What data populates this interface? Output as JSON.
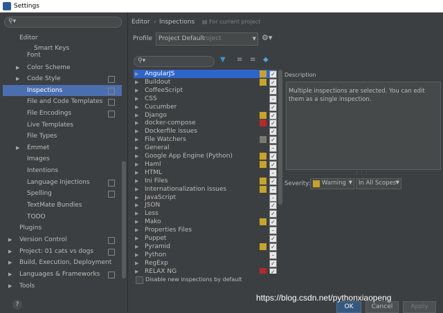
{
  "window": {
    "title": "Settings"
  },
  "sidebar": {
    "search_placeholder": "",
    "items": [
      {
        "label": "Editor",
        "indent": 0,
        "expandable": false
      },
      {
        "label": "Smart Keys",
        "indent": 2,
        "expandable": false
      },
      {
        "label": "Font",
        "indent": 1,
        "expandable": false
      },
      {
        "label": "Color Scheme",
        "indent": 1,
        "expandable": true
      },
      {
        "label": "Code Style",
        "indent": 1,
        "expandable": true,
        "project": true
      },
      {
        "label": "Inspections",
        "indent": 1,
        "expandable": false,
        "project": true,
        "selected": true
      },
      {
        "label": "File and Code Templates",
        "indent": 1,
        "expandable": false,
        "project": true
      },
      {
        "label": "File Encodings",
        "indent": 1,
        "expandable": false,
        "project": true
      },
      {
        "label": "Live Templates",
        "indent": 1,
        "expandable": false
      },
      {
        "label": "File Types",
        "indent": 1,
        "expandable": false
      },
      {
        "label": "Emmet",
        "indent": 1,
        "expandable": true
      },
      {
        "label": "Images",
        "indent": 1,
        "expandable": false
      },
      {
        "label": "Intentions",
        "indent": 1,
        "expandable": false
      },
      {
        "label": "Language Injections",
        "indent": 1,
        "expandable": false,
        "project": true
      },
      {
        "label": "Spelling",
        "indent": 1,
        "expandable": false,
        "project": true
      },
      {
        "label": "TextMate Bundles",
        "indent": 1,
        "expandable": false
      },
      {
        "label": "TODO",
        "indent": 1,
        "expandable": false
      },
      {
        "label": "Plugins",
        "indent": 0,
        "expandable": false
      },
      {
        "label": "Version Control",
        "indent": 0,
        "expandable": true,
        "project": true
      },
      {
        "label": "Project: 01 cats vs dogs",
        "indent": 0,
        "expandable": true,
        "project": true
      },
      {
        "label": "Build, Execution, Deployment",
        "indent": 0,
        "expandable": true
      },
      {
        "label": "Languages & Frameworks",
        "indent": 0,
        "expandable": true,
        "project": true
      },
      {
        "label": "Tools",
        "indent": 0,
        "expandable": true
      }
    ]
  },
  "breadcrumb": {
    "editor": "Editor",
    "inspections": "Inspections",
    "for_project": "For current project"
  },
  "profile": {
    "label": "Profile",
    "value": "Project Default",
    "suffix": "Project"
  },
  "inspections": [
    {
      "label": "AngularJS",
      "severity": "warning",
      "check": "on",
      "selected": true
    },
    {
      "label": "Buildout",
      "severity": "warning",
      "check": "on"
    },
    {
      "label": "CoffeeScript",
      "severity": "",
      "check": "on"
    },
    {
      "label": "CSS",
      "severity": "",
      "check": "partial"
    },
    {
      "label": "Cucumber",
      "severity": "",
      "check": "on"
    },
    {
      "label": "Django",
      "severity": "warning",
      "check": "on"
    },
    {
      "label": "docker-compose",
      "severity": "error",
      "check": "on"
    },
    {
      "label": "Dockerfile issues",
      "severity": "",
      "check": "on"
    },
    {
      "label": "File Watchers",
      "severity": "weak",
      "check": "on"
    },
    {
      "label": "General",
      "severity": "",
      "check": "partial"
    },
    {
      "label": "Google App Engine (Python)",
      "severity": "warning",
      "check": "on"
    },
    {
      "label": "Haml",
      "severity": "warning",
      "check": "on"
    },
    {
      "label": "HTML",
      "severity": "",
      "check": "partial"
    },
    {
      "label": "Ini Files",
      "severity": "warning",
      "check": "on"
    },
    {
      "label": "Internationalization issues",
      "severity": "warning",
      "check": "partial"
    },
    {
      "label": "JavaScript",
      "severity": "",
      "check": "partial"
    },
    {
      "label": "JSON",
      "severity": "",
      "check": "on"
    },
    {
      "label": "Less",
      "severity": "",
      "check": "on"
    },
    {
      "label": "Mako",
      "severity": "warning",
      "check": "on"
    },
    {
      "label": "Properties Files",
      "severity": "",
      "check": "partial"
    },
    {
      "label": "Puppet",
      "severity": "",
      "check": "on"
    },
    {
      "label": "Pyramid",
      "severity": "warning",
      "check": "on"
    },
    {
      "label": "Python",
      "severity": "",
      "check": "partial"
    },
    {
      "label": "RegExp",
      "severity": "",
      "check": "on"
    },
    {
      "label": "RELAX NG",
      "severity": "error",
      "check": "on"
    }
  ],
  "disable_new_label": "Disable new inspections by default",
  "description": {
    "label": "Description",
    "text": "Multiple inspections are selected. You can edit them as a single inspection."
  },
  "severity": {
    "label": "Severity:",
    "value": "Warning",
    "scope": "In All Scopes"
  },
  "buttons": {
    "ok": "OK",
    "cancel": "Cancel",
    "apply": "Apply"
  },
  "watermark": "https://blog.csdn.net/pythonxiaopeng",
  "colors": {
    "selection": "#4b6eaf",
    "warning": "#c7a32b",
    "error": "#b52b2b",
    "weak": "#7a7a6e",
    "background": "#3c3f41"
  }
}
